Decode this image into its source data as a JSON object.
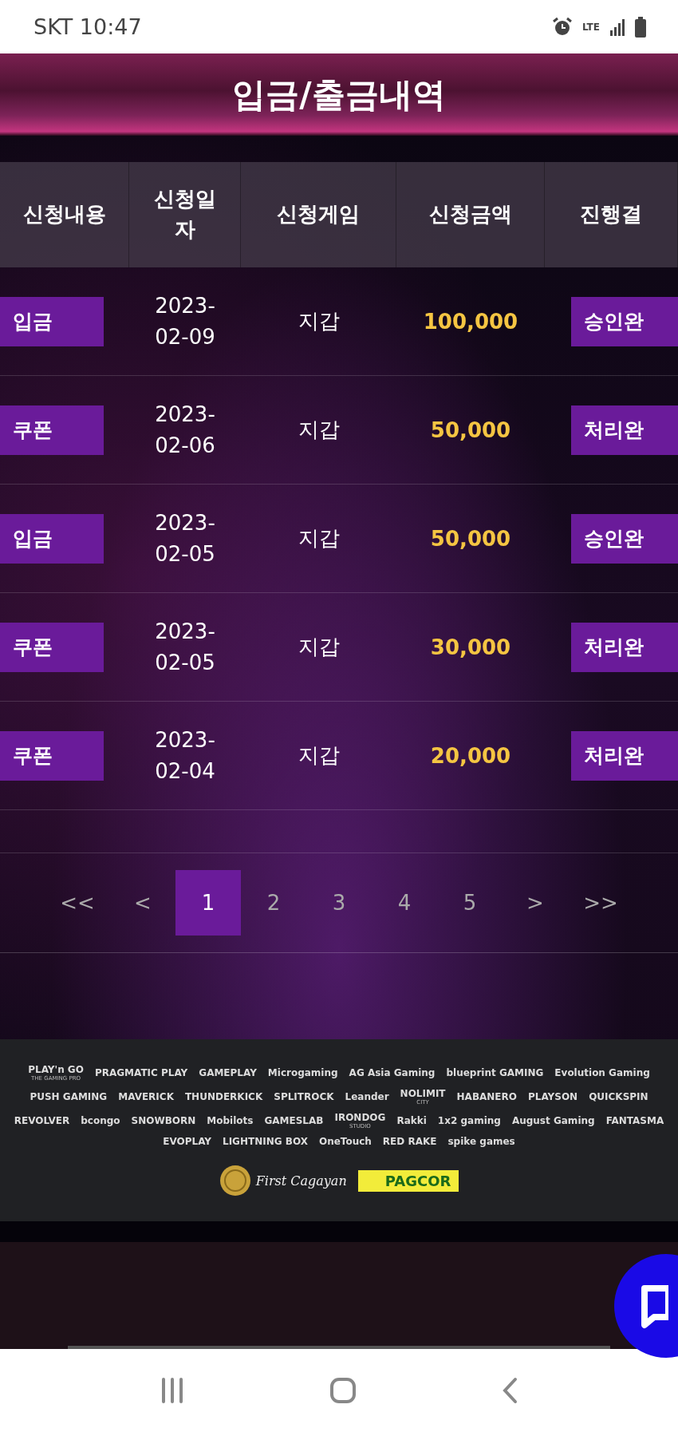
{
  "status_bar": {
    "carrier_time": "SKT 10:47",
    "network": "LTE"
  },
  "header": {
    "title": "입금/출금내역"
  },
  "table": {
    "columns": [
      "신청내용",
      "신청일자",
      "신청게임",
      "신청금액",
      "진행결"
    ],
    "rows": [
      {
        "type": "입금",
        "date": "2023-02-09",
        "game": "지갑",
        "amount": "100,000",
        "result": "승인완"
      },
      {
        "type": "쿠폰",
        "date": "2023-02-06",
        "game": "지갑",
        "amount": "50,000",
        "result": "처리완"
      },
      {
        "type": "입금",
        "date": "2023-02-05",
        "game": "지갑",
        "amount": "50,000",
        "result": "승인완"
      },
      {
        "type": "쿠폰",
        "date": "2023-02-05",
        "game": "지갑",
        "amount": "30,000",
        "result": "처리완"
      },
      {
        "type": "쿠폰",
        "date": "2023-02-04",
        "game": "지갑",
        "amount": "20,000",
        "result": "처리완"
      }
    ]
  },
  "pagination": [
    {
      "label": "<<",
      "selected": false
    },
    {
      "label": "<",
      "selected": false
    },
    {
      "label": "1",
      "selected": true
    },
    {
      "label": "2",
      "selected": false
    },
    {
      "label": "3",
      "selected": false
    },
    {
      "label": "4",
      "selected": false
    },
    {
      "label": "5",
      "selected": false
    },
    {
      "label": ">",
      "selected": false
    },
    {
      "label": ">>",
      "selected": false
    }
  ],
  "partner_logos": [
    {
      "name": "PLAY'n GO",
      "sub": "THE GAMING PRO"
    },
    {
      "name": "PRAGMATIC PLAY"
    },
    {
      "name": "GAMEPLAY"
    },
    {
      "name": "Microgaming"
    },
    {
      "name": "AG Asia Gaming"
    },
    {
      "name": "blueprint GAMING"
    },
    {
      "name": "Evolution Gaming"
    },
    {
      "name": "PUSH GAMING"
    },
    {
      "name": "MAVERICK"
    },
    {
      "name": "THUNDERKICK"
    },
    {
      "name": "SPLITROCK"
    },
    {
      "name": "Leander"
    },
    {
      "name": "NOLIMIT",
      "sub": "CITY"
    },
    {
      "name": "HABANERO"
    },
    {
      "name": "PLAYSON"
    },
    {
      "name": "QUICKSPIN"
    },
    {
      "name": "REVOLVER"
    },
    {
      "name": "bcongo"
    },
    {
      "name": "SNOWBORN"
    },
    {
      "name": "Mobilots"
    },
    {
      "name": "GAMESLAB"
    },
    {
      "name": "IRONDOG",
      "sub": "STUDIO"
    },
    {
      "name": "Rakki"
    },
    {
      "name": "1x2 gaming"
    },
    {
      "name": "August Gaming"
    },
    {
      "name": "FANTASMA"
    },
    {
      "name": "EVOPLAY"
    },
    {
      "name": "LIGHTNING BOX"
    },
    {
      "name": "OneTouch"
    },
    {
      "name": "RED RAKE"
    },
    {
      "name": "spike games"
    }
  ],
  "licenses": [
    {
      "name": "First Cagayan",
      "kind": "seal"
    },
    {
      "name": "PAGCOR",
      "kind": "plate"
    }
  ]
}
